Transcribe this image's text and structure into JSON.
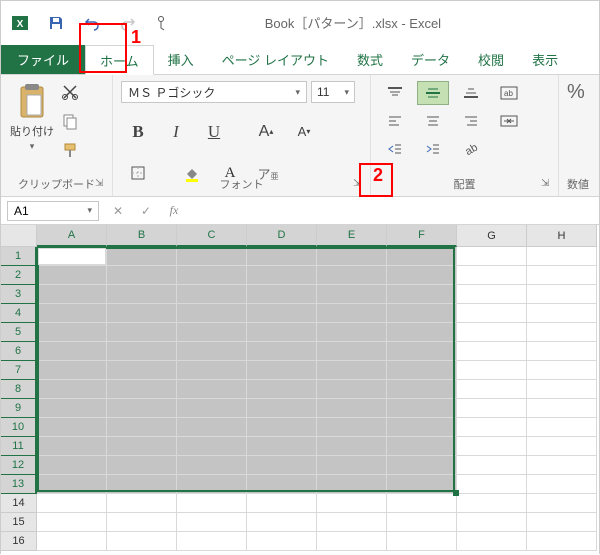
{
  "title": "Book［パターン］.xlsx - Excel",
  "tabs": {
    "file": "ファイル",
    "home": "ホーム",
    "insert": "挿入",
    "pagelayout": "ページ レイアウト",
    "formulas": "数式",
    "data": "データ",
    "review": "校閲",
    "view": "表示"
  },
  "clipboard": {
    "paste_label": "貼り付け",
    "group_label": "クリップボード"
  },
  "font": {
    "name": "ＭＳ Ｐゴシック",
    "size": "11",
    "group_label": "フォント",
    "bold": "B",
    "italic": "I",
    "underline": "U",
    "grow": "A",
    "shrink": "A"
  },
  "alignment": {
    "group_label": "配置"
  },
  "number": {
    "pct": "%",
    "label": "数値"
  },
  "namebox": "A1",
  "fx": "fx",
  "columns": [
    "A",
    "B",
    "C",
    "D",
    "E",
    "F",
    "G",
    "H"
  ],
  "rows": [
    "1",
    "2",
    "3",
    "4",
    "5",
    "6",
    "7",
    "8",
    "9",
    "10",
    "11",
    "12",
    "13",
    "14",
    "15",
    "16"
  ],
  "selected_cols": 6,
  "selected_rows": 13,
  "annotations": {
    "one": "1",
    "two": "2"
  }
}
